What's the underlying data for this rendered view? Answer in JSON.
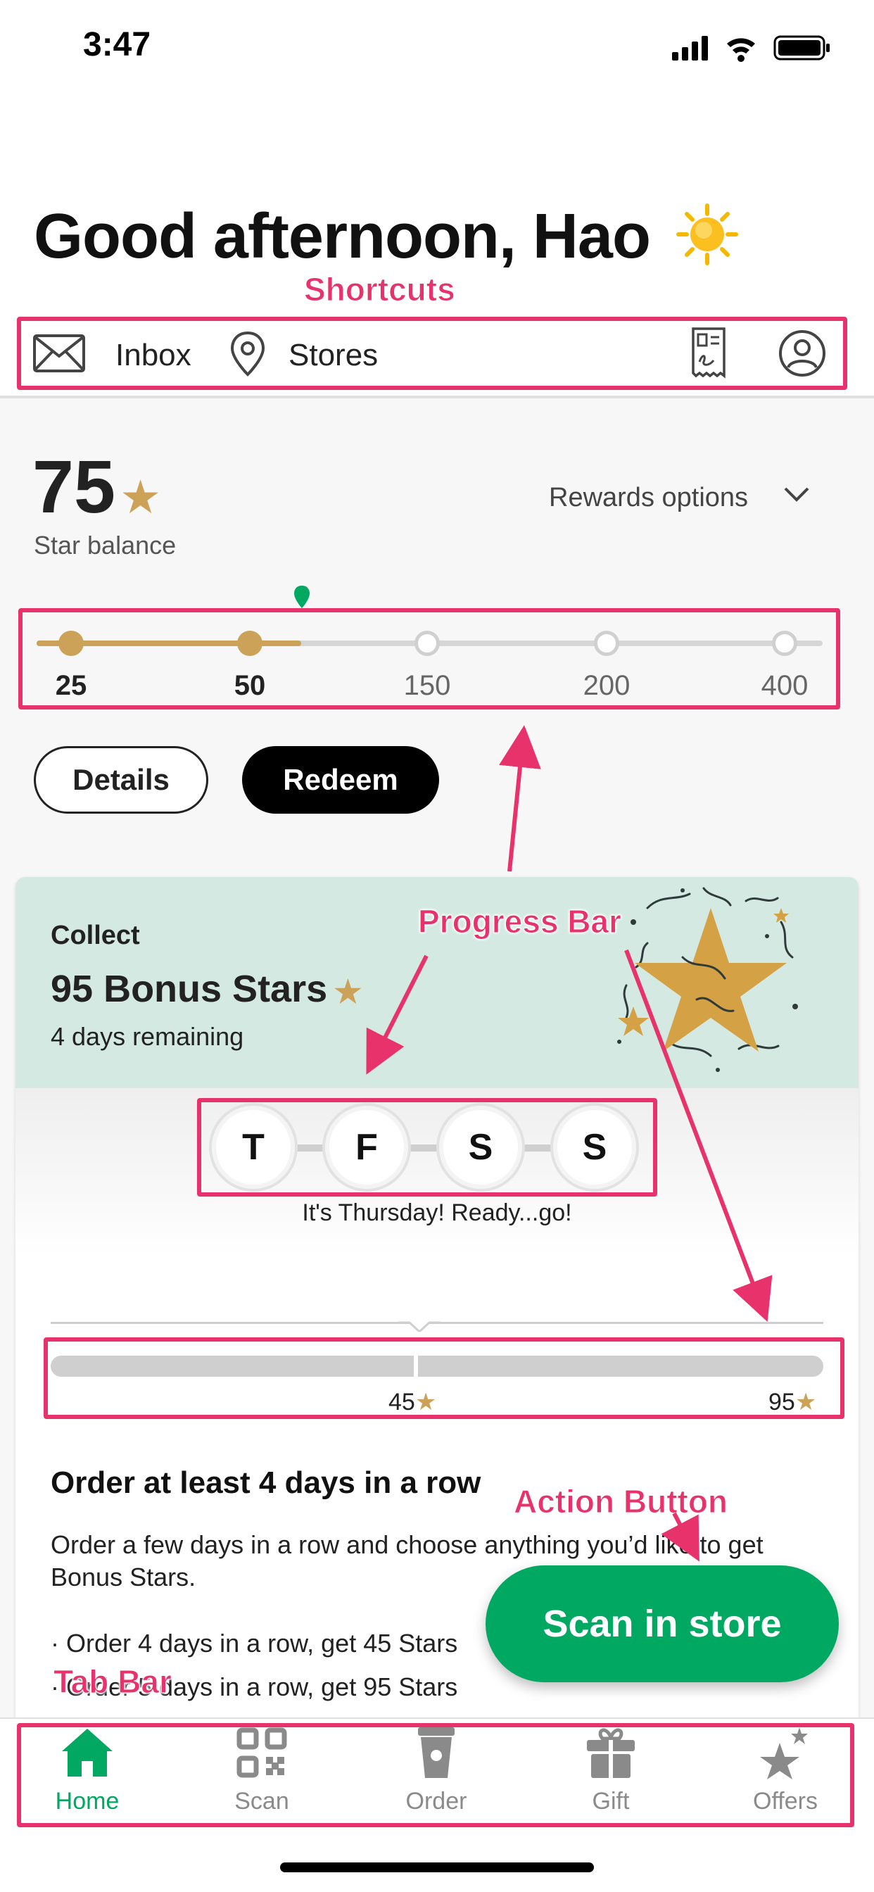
{
  "status_bar": {
    "time": "3:47"
  },
  "header": {
    "greeting": "Good afternoon, Hao",
    "weather_icon": "sun-icon"
  },
  "shortcuts": {
    "inbox_label": "Inbox",
    "stores_label": "Stores",
    "icons": [
      "mail-icon",
      "location-pin-icon",
      "receipt-icon",
      "account-icon"
    ]
  },
  "rewards": {
    "star_balance": "75",
    "star_balance_label": "Star balance",
    "rewards_options_label": "Rewards options",
    "tiers": [
      "25",
      "50",
      "150",
      "200",
      "400"
    ],
    "tiers_reached": 2,
    "details_button": "Details",
    "redeem_button": "Redeem"
  },
  "bonus_card": {
    "collect_label": "Collect",
    "title": "95 Bonus Stars",
    "days_remaining": "4 days remaining",
    "days": [
      "T",
      "F",
      "S",
      "S"
    ],
    "day_caption": "It's Thursday! Ready...go!",
    "milestone_1": "45",
    "milestone_2": "95",
    "order_heading": "Order at least 4 days in a row",
    "order_description": "Order a few days in a row  and choose anything you’d like to get Bonus Stars.",
    "bullet_1": "· Order 4 days in a row, get 45 Stars",
    "bullet_2": "· Order 5 days in a row, get 95 Stars"
  },
  "scan_button": {
    "label": "Scan in store"
  },
  "tab_bar": {
    "tabs": [
      {
        "label": "Home",
        "icon": "home-icon",
        "active": true
      },
      {
        "label": "Scan",
        "icon": "qr-code-icon",
        "active": false
      },
      {
        "label": "Order",
        "icon": "cup-icon",
        "active": false
      },
      {
        "label": "Gift",
        "icon": "gift-icon",
        "active": false
      },
      {
        "label": "Offers",
        "icon": "stars-icon",
        "active": false
      }
    ]
  },
  "annotations": {
    "shortcuts": "Shortcuts",
    "progress_bar": "Progress Bar",
    "action_button": "Action Button",
    "tab_bar": "Tab Bar"
  },
  "colors": {
    "brand_green": "#00a862",
    "gold": "#cba258",
    "annotation_pink": "#e8326c",
    "card_mint": "#d4e9e2"
  }
}
